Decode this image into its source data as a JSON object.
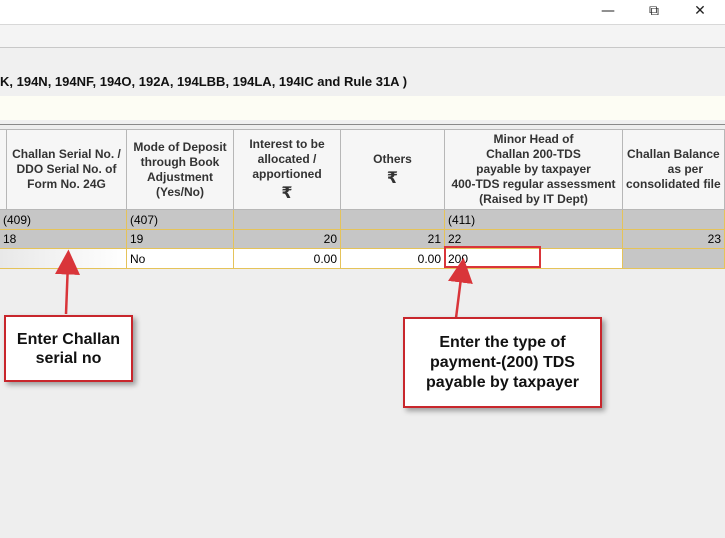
{
  "window": {
    "minimize_glyph": "—",
    "restore_glyph": "⧉",
    "close_glyph": "✕"
  },
  "section_title": "K, 194N, 194NF, 194O, 192A, 194LBB, 194LA, 194IC and Rule 31A )",
  "table": {
    "columns": [
      {
        "header": "Challan Serial No. / DDO Serial No. of Form No. 24G",
        "code": "(409)",
        "num": "18",
        "value": ""
      },
      {
        "header": "Mode of Deposit through Book Adjustment (Yes/No)",
        "code": "(407)",
        "num": "19",
        "value": "No"
      },
      {
        "header": "Interest to be allocated / apportioned",
        "rupee": "₹",
        "code": "",
        "num": "20",
        "value": "0.00"
      },
      {
        "header": "Others",
        "rupee": "₹",
        "code": "",
        "num": "21",
        "value": "0.00"
      },
      {
        "header_lines": [
          "Minor Head of",
          "Challan 200-TDS",
          "payable by taxpayer",
          "400-TDS regular assessment",
          "(Raised by IT Dept)"
        ],
        "code": "(411)",
        "num": "22",
        "value": "200"
      },
      {
        "header": "Challan Balance as per consolidated file",
        "code": "",
        "num": "23",
        "value": ""
      }
    ]
  },
  "callouts": {
    "challan": "Enter Challan serial no",
    "payment": "Enter the type of payment-(200) TDS payable by taxpayer"
  },
  "colors": {
    "callout_border": "#c8262c",
    "arrow": "#d9353a",
    "grid_accent": "#e5c35a"
  }
}
